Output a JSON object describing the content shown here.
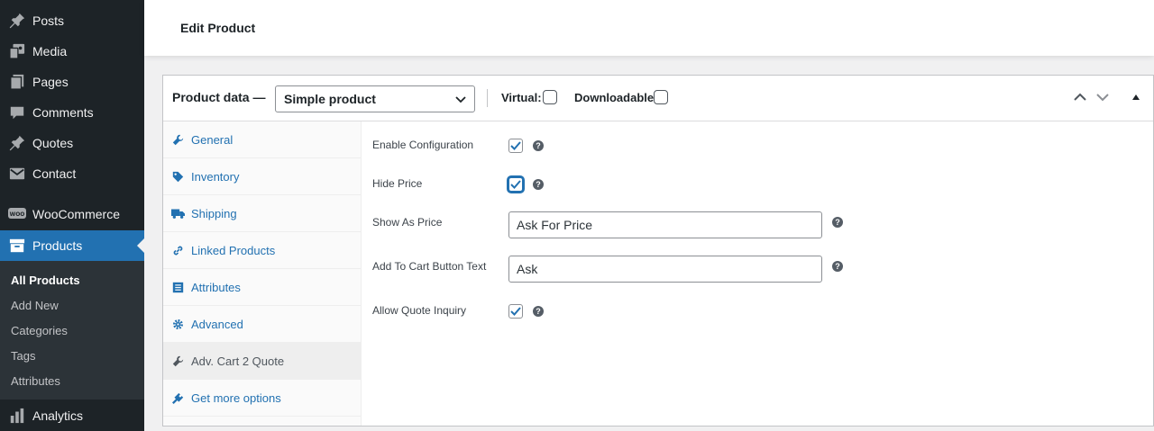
{
  "sidebar": {
    "items": [
      {
        "label": "Posts",
        "icon": "pin-icon"
      },
      {
        "label": "Media",
        "icon": "media-icon"
      },
      {
        "label": "Pages",
        "icon": "pages-icon"
      },
      {
        "label": "Comments",
        "icon": "comments-icon"
      },
      {
        "label": "Quotes",
        "icon": "pin-icon"
      },
      {
        "label": "Contact",
        "icon": "mail-icon"
      },
      {
        "label": "WooCommerce",
        "icon": "woo-icon"
      },
      {
        "label": "Products",
        "icon": "archive-icon"
      },
      {
        "label": "Analytics",
        "icon": "chart-icon"
      }
    ],
    "submenu": [
      "All Products",
      "Add New",
      "Categories",
      "Tags",
      "Attributes"
    ]
  },
  "header": {
    "title": "Edit Product"
  },
  "product_data": {
    "title": "Product data —",
    "type_select": "Simple product",
    "virtual_label": "Virtual:",
    "downloadable_label": "Downloadable:",
    "tabs": [
      {
        "label": "General",
        "icon": "wrench-icon"
      },
      {
        "label": "Inventory",
        "icon": "tag-icon"
      },
      {
        "label": "Shipping",
        "icon": "truck-icon"
      },
      {
        "label": "Linked Products",
        "icon": "link-icon"
      },
      {
        "label": "Attributes",
        "icon": "list-icon"
      },
      {
        "label": "Advanced",
        "icon": "gear-icon"
      },
      {
        "label": "Adv. Cart 2 Quote",
        "icon": "wrench-icon"
      },
      {
        "label": "Get more options",
        "icon": "plugin-icon"
      }
    ],
    "fields": {
      "enable_configuration": {
        "label": "Enable Configuration",
        "checked": true
      },
      "hide_price": {
        "label": "Hide Price",
        "checked": true
      },
      "show_as_price": {
        "label": "Show As Price",
        "value": "Ask For Price"
      },
      "add_to_cart_text": {
        "label": "Add To Cart Button Text",
        "value": "Ask"
      },
      "allow_quote_inquiry": {
        "label": "Allow Quote Inquiry",
        "checked": true
      }
    },
    "help_glyph": "?"
  },
  "colors": {
    "accent": "#2271b1",
    "sidebar_bg": "#1d2327",
    "submenu_bg": "#2c3338"
  }
}
